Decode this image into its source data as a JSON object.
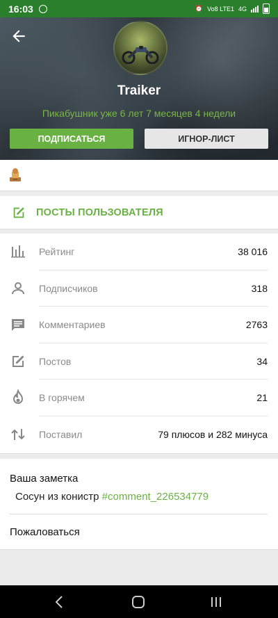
{
  "status_bar": {
    "time": "16:03",
    "carrier": "Vo8 LTE1",
    "network": "4G"
  },
  "profile": {
    "username": "Traiker",
    "member_since": "Пикабушник уже 6 лет 7 месяцев 4 недели",
    "subscribe_label": "ПОДПИСАТЬСЯ",
    "ignore_label": "ИГНОР-ЛИСТ"
  },
  "posts_link": {
    "label": "ПОСТЫ ПОЛЬЗОВАТЕЛЯ"
  },
  "stats": [
    {
      "icon": "rating-icon",
      "label": "Рейтинг",
      "value": "38 016"
    },
    {
      "icon": "user-icon",
      "label": "Подписчиков",
      "value": "318"
    },
    {
      "icon": "comment-icon",
      "label": "Комментариев",
      "value": "2763"
    },
    {
      "icon": "edit-icon",
      "label": "Постов",
      "value": "34"
    },
    {
      "icon": "flame-icon",
      "label": "В горячем",
      "value": "21"
    },
    {
      "icon": "updown-icon",
      "label": "Поставил",
      "value": "79 плюсов и 282 минуса"
    }
  ],
  "note": {
    "title": "Ваша заметка",
    "text": "Сосун из конистр",
    "tag": "#comment_226534779",
    "report_label": "Пожаловаться"
  },
  "colors": {
    "accent": "#6ab144",
    "status_bar": "#2a7f2c"
  }
}
